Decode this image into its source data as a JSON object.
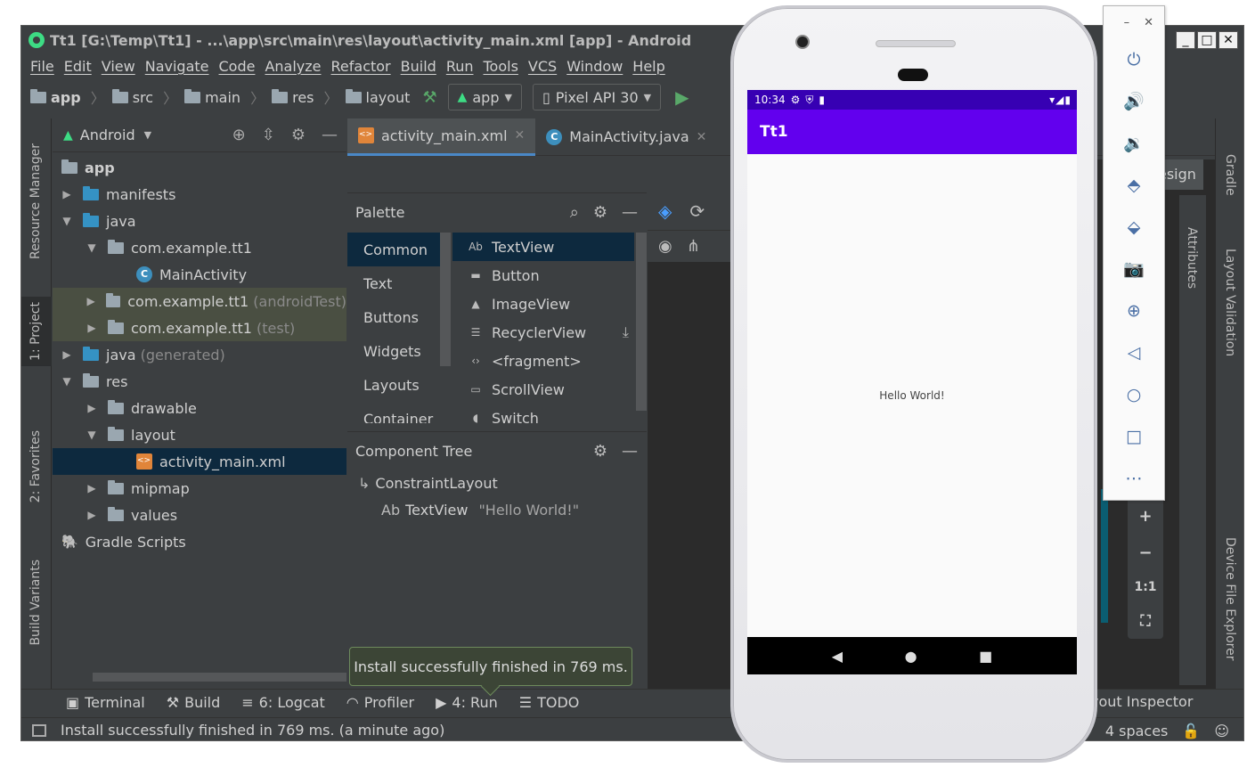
{
  "ide": {
    "title": "Tt1 [G:\\Temp\\Tt1] - ...\\app\\src\\main\\res\\layout\\activity_main.xml [app] - Android",
    "menu": [
      "File",
      "Edit",
      "View",
      "Navigate",
      "Code",
      "Analyze",
      "Refactor",
      "Build",
      "Run",
      "Tools",
      "VCS",
      "Window",
      "Help"
    ],
    "breadcrumbs": [
      "app",
      "src",
      "main",
      "res",
      "layout"
    ],
    "run_config": "app",
    "device": "Pixel API 30",
    "left_tabs": [
      "Resource Manager",
      "1: Project",
      "2: Favorites",
      "Build Variants"
    ],
    "project_view": "Android",
    "tree": [
      {
        "label": "app",
        "extra": ""
      },
      {
        "label": "manifests",
        "extra": ""
      },
      {
        "label": "java",
        "extra": ""
      },
      {
        "label": "com.example.tt1",
        "extra": ""
      },
      {
        "label": "MainActivity",
        "extra": ""
      },
      {
        "label": "com.example.tt1",
        "extra": "(androidTest)"
      },
      {
        "label": "com.example.tt1",
        "extra": "(test)"
      },
      {
        "label": "java",
        "extra": "(generated)"
      },
      {
        "label": "res",
        "extra": ""
      },
      {
        "label": "drawable",
        "extra": ""
      },
      {
        "label": "layout",
        "extra": ""
      },
      {
        "label": "activity_main.xml",
        "extra": ""
      },
      {
        "label": "mipmap",
        "extra": ""
      },
      {
        "label": "values",
        "extra": ""
      },
      {
        "label": "Gradle Scripts",
        "extra": ""
      }
    ],
    "editor_tabs": [
      "activity_main.xml",
      "MainActivity.java"
    ],
    "palette": {
      "title": "Palette",
      "categories": [
        "Common",
        "Text",
        "Buttons",
        "Widgets",
        "Layouts",
        "Container"
      ],
      "items": [
        "TextView",
        "Button",
        "ImageView",
        "RecyclerView",
        "<fragment>",
        "ScrollView",
        "Switch"
      ]
    },
    "component_tree": {
      "title": "Component Tree",
      "root": "ConstraintLayout",
      "child": "TextView",
      "child_text": "\"Hello World!\""
    },
    "design_label": "esign",
    "right_tabs": [
      "Gradle",
      "Layout Validation",
      "Device File Explorer"
    ],
    "attributes_tab": "Attributes",
    "zoom": [
      "+",
      "−",
      "1:1"
    ],
    "bottom_tabs": [
      "Terminal",
      "Build",
      "6: Logcat",
      "Profiler",
      "4: Run",
      "TODO"
    ],
    "layout_inspector": "yout Inspector",
    "status_text": "Install successfully finished in 769 ms. (a minute ago)",
    "indent": "4 spaces",
    "toast": "Install successfully finished in 769 ms."
  },
  "emulator": {
    "time": "10:34",
    "app_title": "Tt1",
    "hello_text": "Hello World!",
    "toolbar_icons": [
      "power-icon",
      "volume-up-icon",
      "volume-down-icon",
      "rotate-left-icon",
      "rotate-right-icon",
      "camera-icon",
      "zoom-icon",
      "back-icon",
      "home-icon",
      "overview-icon",
      "more-icon"
    ]
  },
  "colors": {
    "ide_bg": "#3c3f41",
    "status_bar": "#3700b3",
    "app_bar": "#6200ee",
    "selection": "#0d293e",
    "run_green": "#59a869"
  }
}
